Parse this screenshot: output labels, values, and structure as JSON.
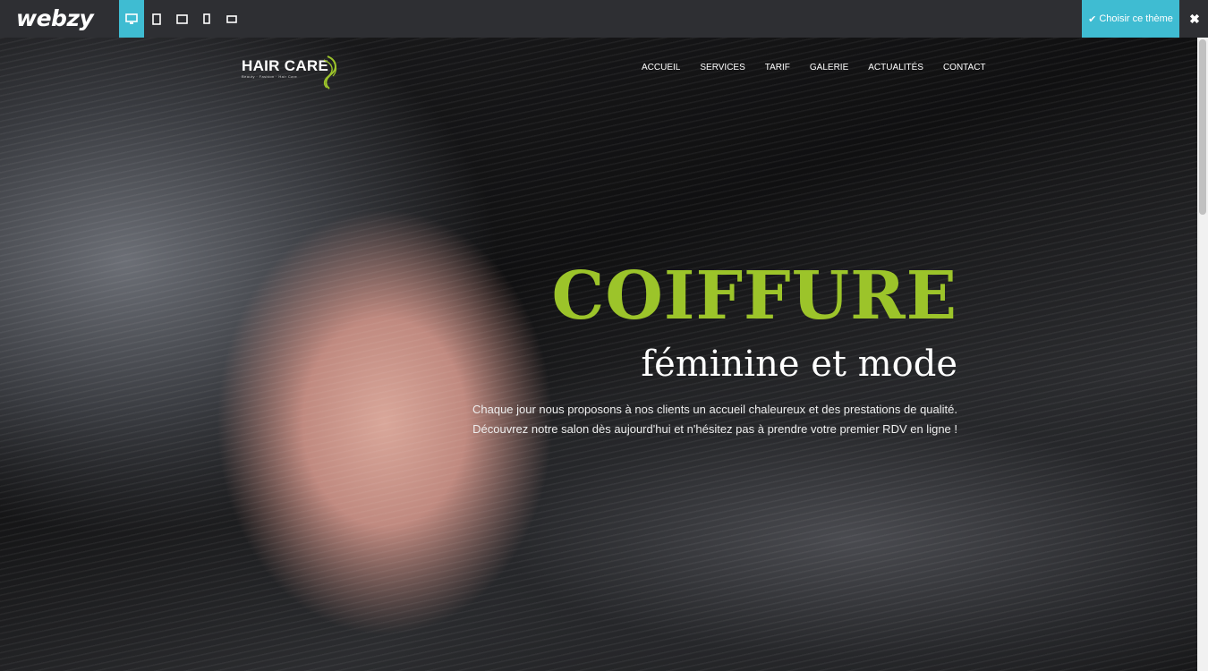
{
  "builder": {
    "brand": "webzy",
    "devices": [
      {
        "name": "desktop-icon",
        "active": true
      },
      {
        "name": "tablet-portrait-icon",
        "active": false
      },
      {
        "name": "tablet-landscape-icon",
        "active": false
      },
      {
        "name": "phone-portrait-icon",
        "active": false
      },
      {
        "name": "phone-landscape-icon",
        "active": false
      }
    ],
    "choose_label": "Choisir ce thème",
    "close_label": "✖",
    "accent": "#3fbcd2"
  },
  "site": {
    "logo_text": "HAIR CARE",
    "logo_sub": "Beauty · Fashion · Hair Care",
    "nav": [
      "ACCUEIL",
      "SERVICES",
      "TARIF",
      "GALERIE",
      "ACTUALITÉS",
      "CONTACT"
    ],
    "headline": "COIFFURE",
    "subheadline": "féminine et mode",
    "description": [
      "Chaque jour nous proposons à nos clients un accueil chaleureux et des prestations de qualité.",
      "Découvrez notre salon dès aujourd'hui et n'hésitez pas à prendre votre premier RDV en ligne !"
    ],
    "accent": "#9cc42a"
  }
}
